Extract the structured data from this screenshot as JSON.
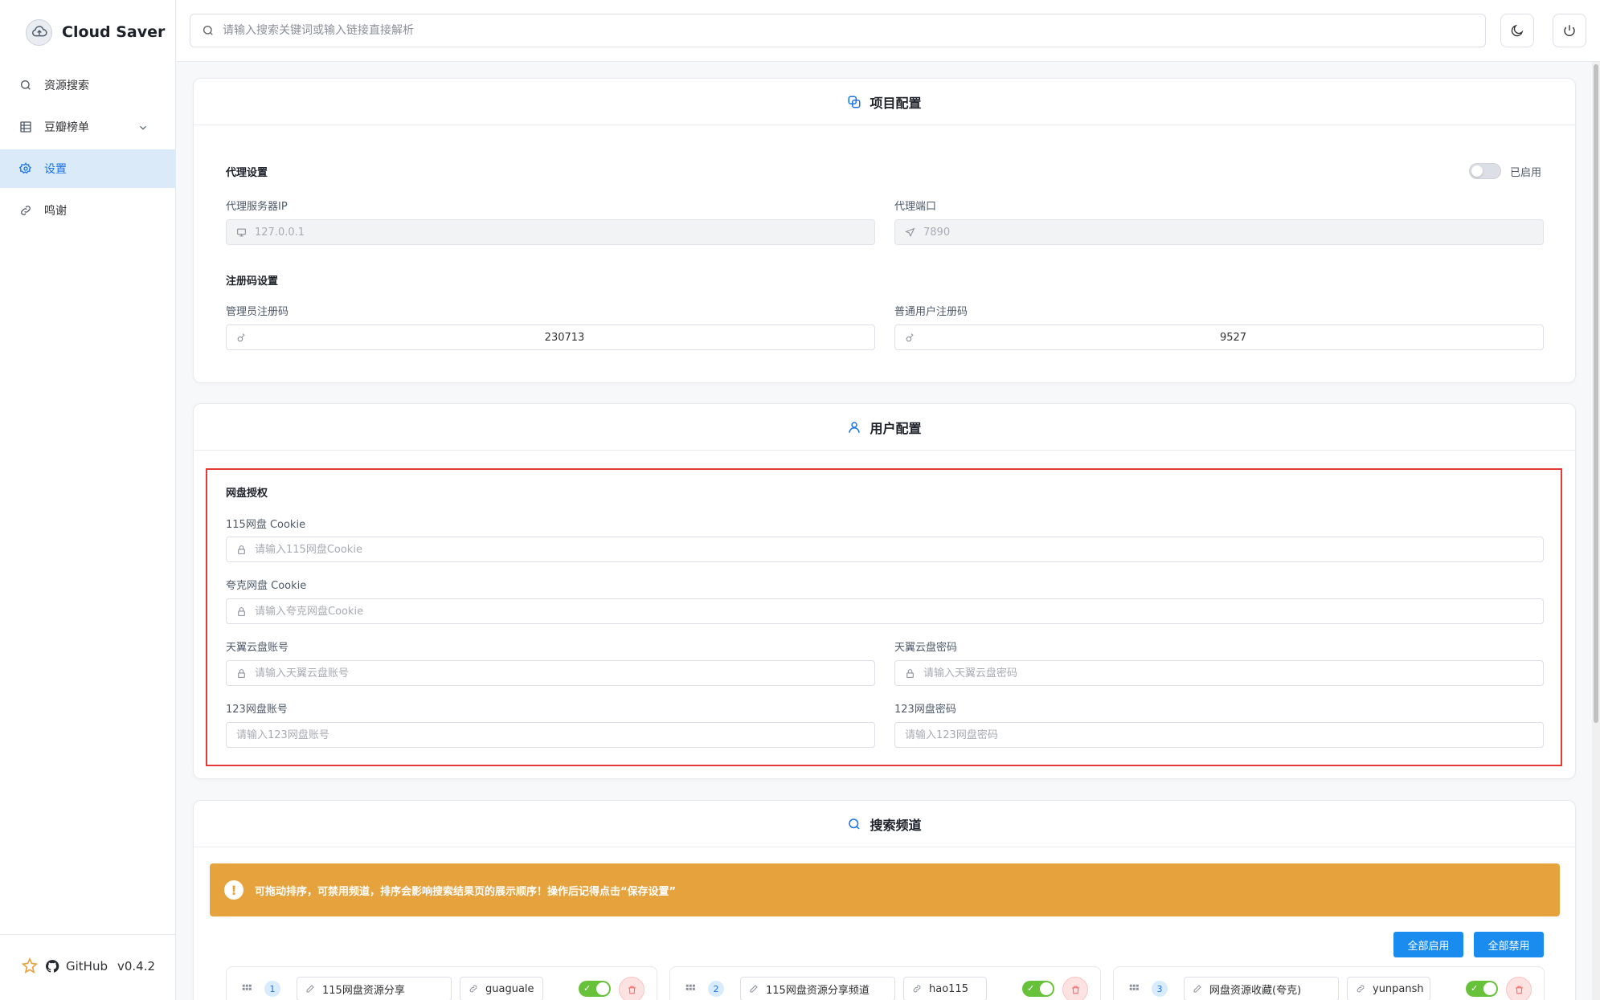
{
  "app": {
    "name": "Cloud Saver",
    "version": "v0.4.2",
    "github_label": "GitHub"
  },
  "sidebar": {
    "items": [
      {
        "label": "资源搜索",
        "icon": "search-icon"
      },
      {
        "label": "豆瓣榜单",
        "icon": "grid-icon"
      },
      {
        "label": "设置",
        "icon": "gear-icon",
        "active": true
      },
      {
        "label": "鸣谢",
        "icon": "link-icon"
      }
    ]
  },
  "header": {
    "search_placeholder": "请输入搜索关键词或输入链接直接解析"
  },
  "project_config": {
    "title": "项目配置",
    "proxy": {
      "section": "代理设置",
      "toggle_label": "已启用",
      "enabled": false,
      "ip_label": "代理服务器IP",
      "ip_value": "127.0.0.1",
      "port_label": "代理端口",
      "port_value": "7890"
    },
    "register": {
      "section": "注册码设置",
      "admin_label": "管理员注册码",
      "admin_value": "230713",
      "user_label": "普通用户注册码",
      "user_value": "9527"
    }
  },
  "user_config": {
    "title": "用户配置",
    "section": "网盘授权",
    "c115_label": "115网盘 Cookie",
    "c115_placeholder": "请输入115网盘Cookie",
    "quark_label": "夸克网盘 Cookie",
    "quark_placeholder": "请输入夸克网盘Cookie",
    "tianyi_account_label": "天翼云盘账号",
    "tianyi_account_placeholder": "请输入天翼云盘账号",
    "tianyi_password_label": "天翼云盘密码",
    "tianyi_password_placeholder": "请输入天翼云盘密码",
    "p123_account_label": "123网盘账号",
    "p123_account_placeholder": "请输入123网盘账号",
    "p123_password_label": "123网盘密码",
    "p123_password_placeholder": "请输入123网盘密码"
  },
  "search_channels": {
    "title": "搜索频道",
    "alert": "可拖动排序，可禁用频道，排序会影响搜索结果页的展示顺序！操作后记得点击“保存设置”",
    "enable_all": "全部启用",
    "disable_all": "全部禁用",
    "channels": [
      {
        "index": "1",
        "name": "115网盘资源分享",
        "id": "guaguale"
      },
      {
        "index": "2",
        "name": "115网盘资源分享频道",
        "id": "hao115"
      },
      {
        "index": "3",
        "name": "网盘资源收藏(夸克)",
        "id": "yunpansh"
      }
    ]
  },
  "colors": {
    "accent": "#1a73e8",
    "warning": "#e6a23c",
    "success": "#67c23a",
    "danger": "#f56c6c",
    "highlight": "#e53935"
  }
}
